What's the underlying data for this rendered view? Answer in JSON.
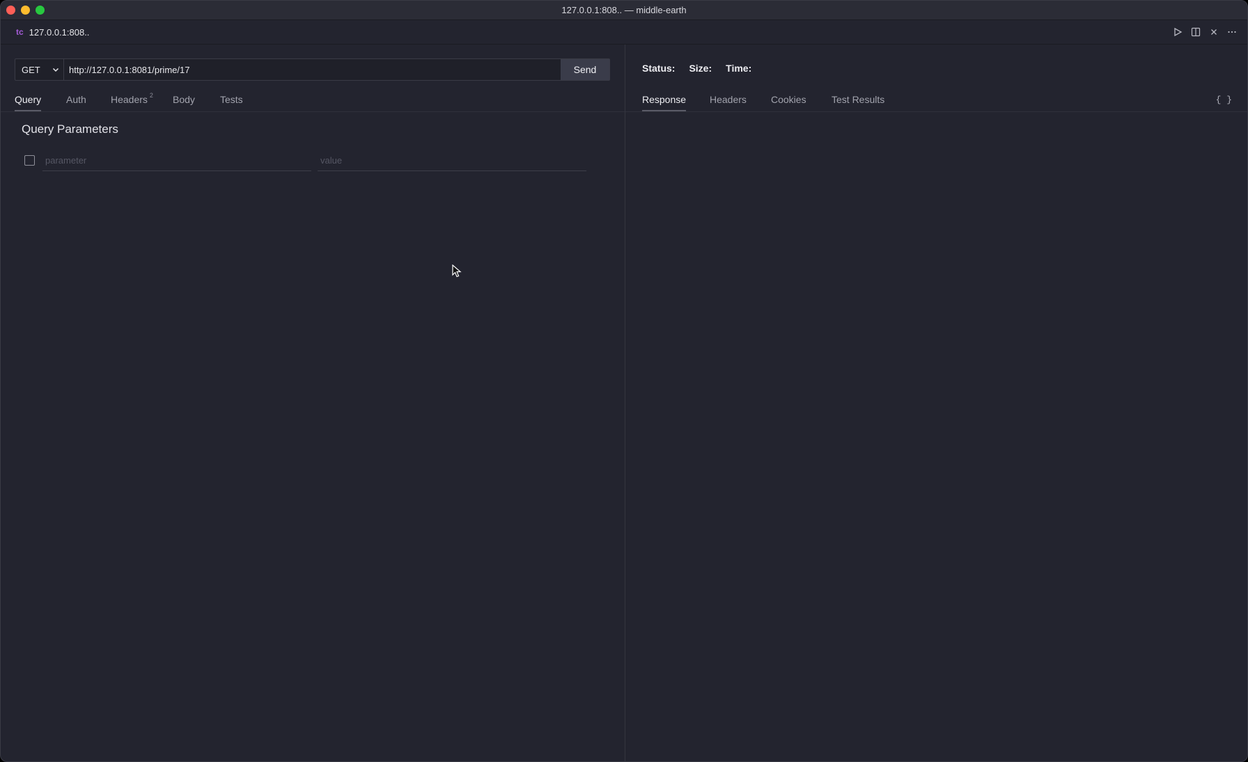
{
  "window": {
    "title": "127.0.0.1:808.. — middle-earth"
  },
  "tab": {
    "badge": "tc",
    "label": "127.0.0.1:808.."
  },
  "tab_actions": [
    {
      "icon": "play-icon"
    },
    {
      "icon": "split-view-icon"
    },
    {
      "icon": "close-icon"
    },
    {
      "icon": "more-icon"
    }
  ],
  "request": {
    "method": "GET",
    "url": "http://127.0.0.1:8081/prime/17",
    "send_label": "Send",
    "tabs": {
      "query": "Query",
      "auth": "Auth",
      "headers": "Headers",
      "headers_count": "2",
      "body": "Body",
      "tests": "Tests"
    },
    "active_tab": "Query",
    "query_params": {
      "title": "Query Parameters",
      "param_placeholder": "parameter",
      "value_placeholder": "value"
    }
  },
  "response": {
    "status_label": "Status:",
    "size_label": "Size:",
    "time_label": "Time:",
    "tabs": {
      "response": "Response",
      "headers": "Headers",
      "cookies": "Cookies",
      "test_results": "Test Results"
    },
    "active_tab": "Response",
    "format_toggle": "{ }"
  },
  "colors": {
    "background": "#23242f",
    "accent_badge": "#a35bd6",
    "send_button": "#3a3c4a"
  }
}
